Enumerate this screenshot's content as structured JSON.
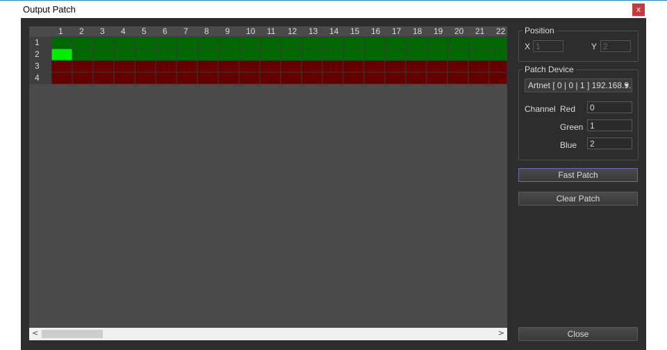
{
  "window": {
    "title": "Output Patch",
    "close_glyph": "x"
  },
  "grid": {
    "col_labels": [
      "1",
      "2",
      "3",
      "4",
      "5",
      "6",
      "7",
      "8",
      "9",
      "10",
      "11",
      "12",
      "13",
      "14",
      "15",
      "16",
      "17",
      "18",
      "19",
      "20",
      "21",
      "22"
    ],
    "rows": [
      {
        "label": "1",
        "state": "patched"
      },
      {
        "label": "2",
        "state": "patched"
      },
      {
        "label": "3",
        "state": "unpatched"
      },
      {
        "label": "4",
        "state": "unpatched"
      }
    ],
    "selected": {
      "row": 2,
      "col": 1
    },
    "colors": {
      "patched": "#006800",
      "unpatched": "#650000",
      "selected": "#00f000",
      "grid_line": "#3a3a3a",
      "header_bg": "#4a4a4a",
      "row_header_bg": "#3e3e3e"
    }
  },
  "scrollbar": {
    "left_glyph": "<",
    "right_glyph": ">"
  },
  "position": {
    "title": "Position",
    "x_label": "X",
    "x_value": "1",
    "y_label": "Y",
    "y_value": "2"
  },
  "patch_device": {
    "title": "Patch Device",
    "device": "Artnet [ 0 | 0 | 1 ] 192.168.9.`",
    "channel_label": "Channel",
    "red_label": "Red",
    "red_value": "0",
    "green_label": "Green",
    "green_value": "1",
    "blue_label": "Blue",
    "blue_value": "2"
  },
  "buttons": {
    "fast_patch": "Fast Patch",
    "clear_patch": "Clear Patch",
    "close": "Close"
  }
}
